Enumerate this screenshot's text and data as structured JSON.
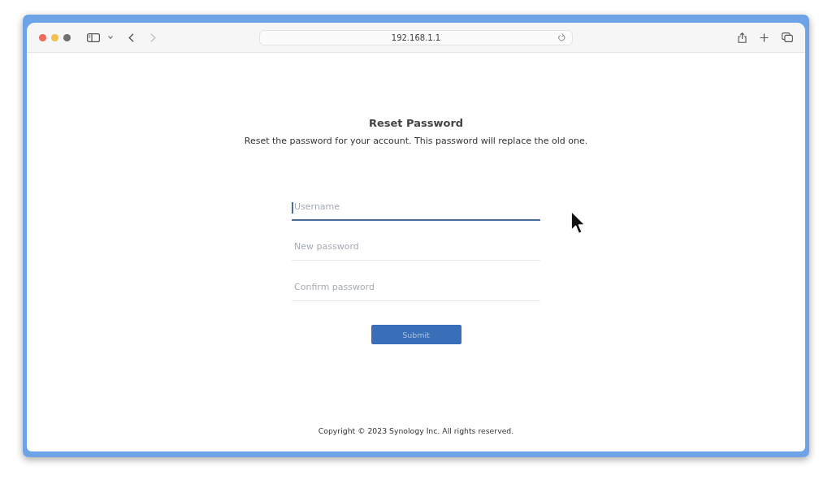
{
  "browser": {
    "window_controls": [
      {
        "color": "#ec6a5e"
      },
      {
        "color": "#f4bf4f"
      },
      {
        "color": "#6e716f"
      }
    ],
    "back_enabled": true,
    "forward_enabled": false,
    "address": "192.168.1.1"
  },
  "page": {
    "title": "Reset Password",
    "description": "Reset the password for your account. This password will replace the old one.",
    "fields": [
      {
        "placeholder": "Username",
        "focused": true
      },
      {
        "placeholder": "New password",
        "focused": false
      },
      {
        "placeholder": "Confirm password",
        "focused": false
      }
    ],
    "submit": {
      "label": "Submit",
      "disabled": true
    },
    "footer": "Copyright © 2023 Synology Inc. All rights reserved."
  }
}
